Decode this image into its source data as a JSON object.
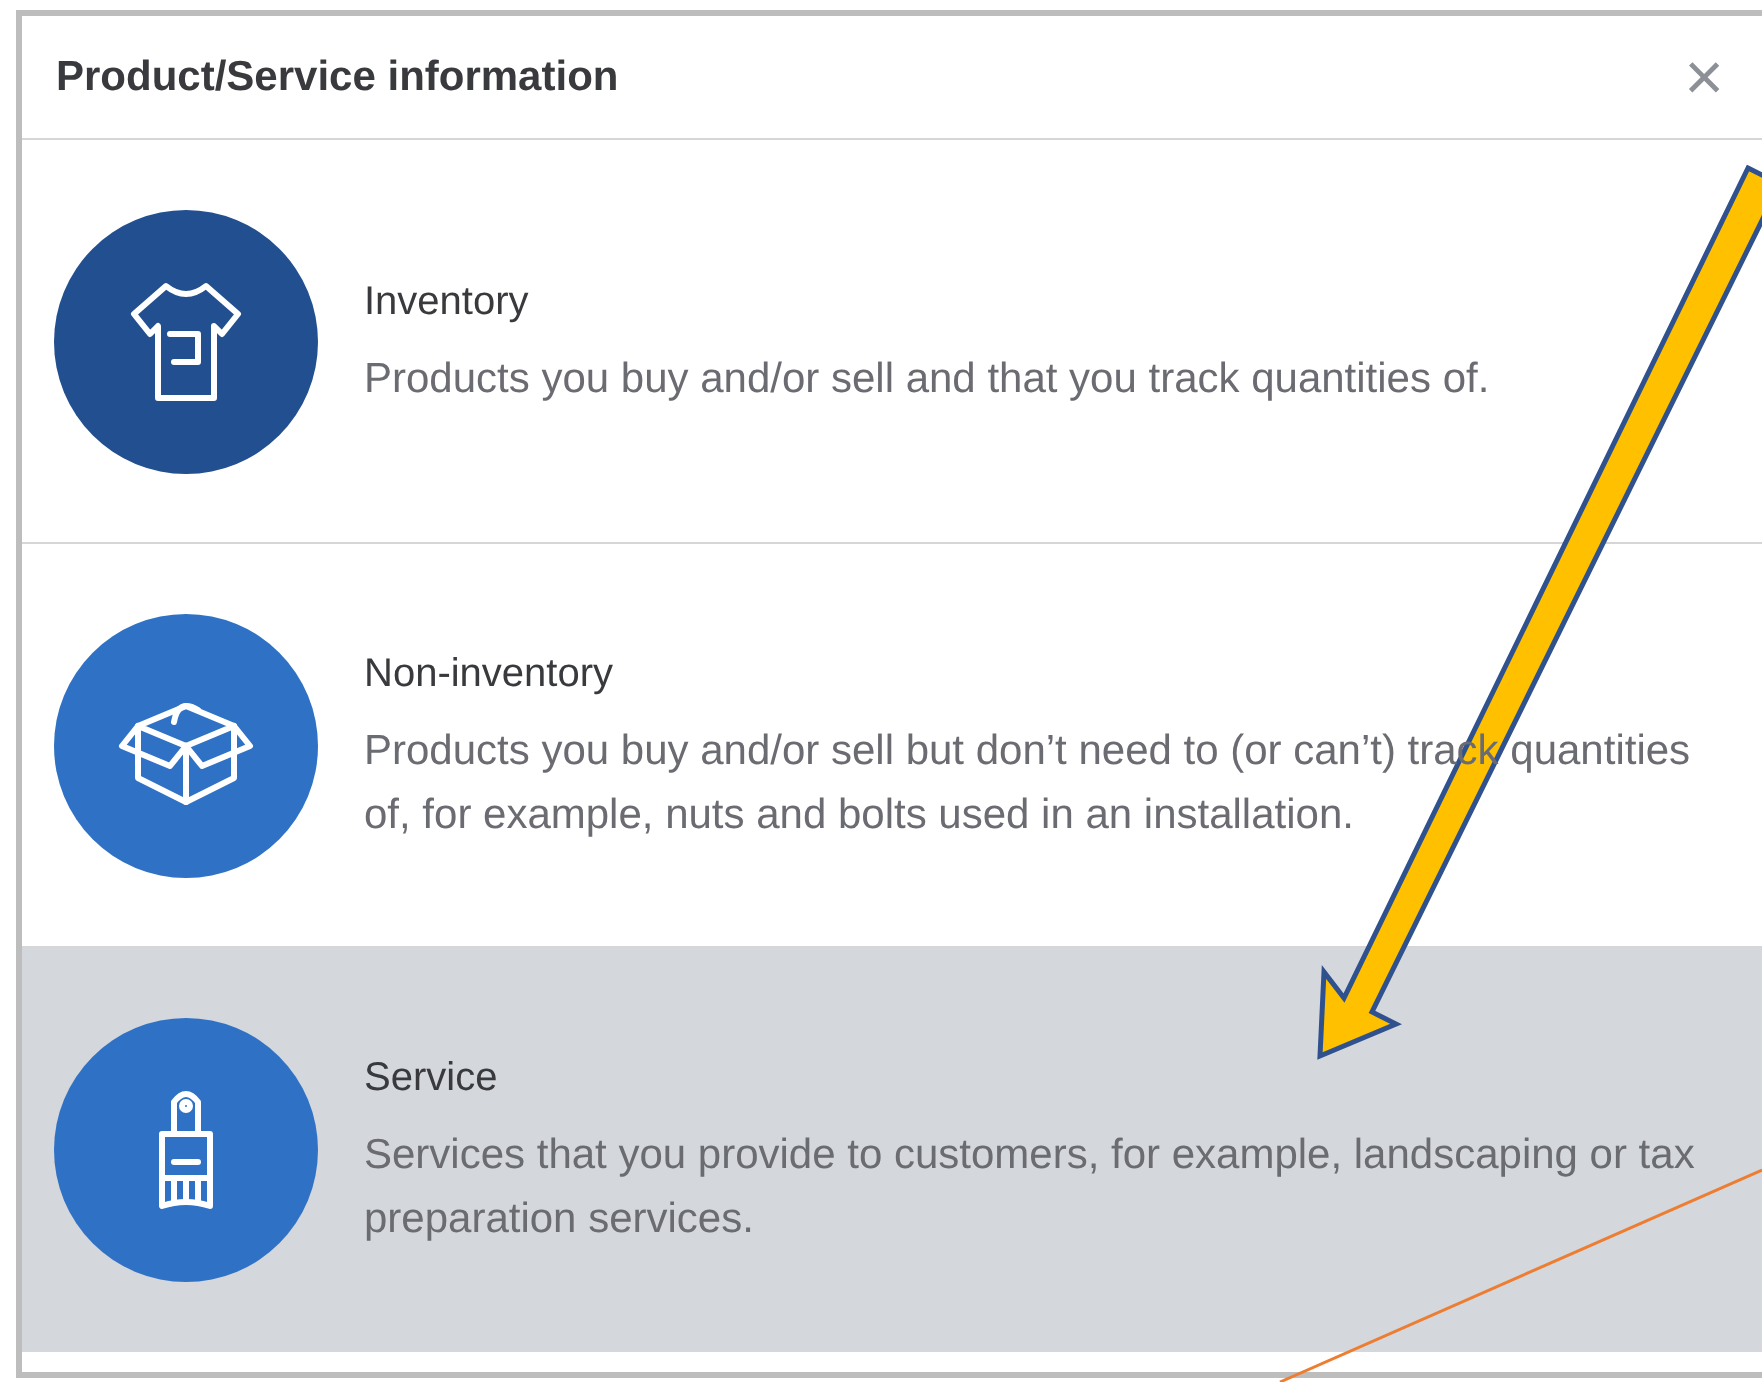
{
  "dialog": {
    "title": "Product/Service information",
    "close": "×"
  },
  "options": [
    {
      "kind": "shirt",
      "color": "#224f8f",
      "title": "Inventory",
      "description": "Products you buy and/or sell and that you track quantities of.",
      "selected": false
    },
    {
      "kind": "box",
      "color": "#2f72c5",
      "title": "Non-inventory",
      "description": "Products you buy and/or sell but don’t need to (or can’t) track quantities of, for example, nuts and bolts used in an installation.",
      "selected": false
    },
    {
      "kind": "brush",
      "color": "#2f72c5",
      "title": "Service",
      "description": "Services that you provide to customers, for example, landscaping or tax preparation services.",
      "selected": true
    }
  ]
}
